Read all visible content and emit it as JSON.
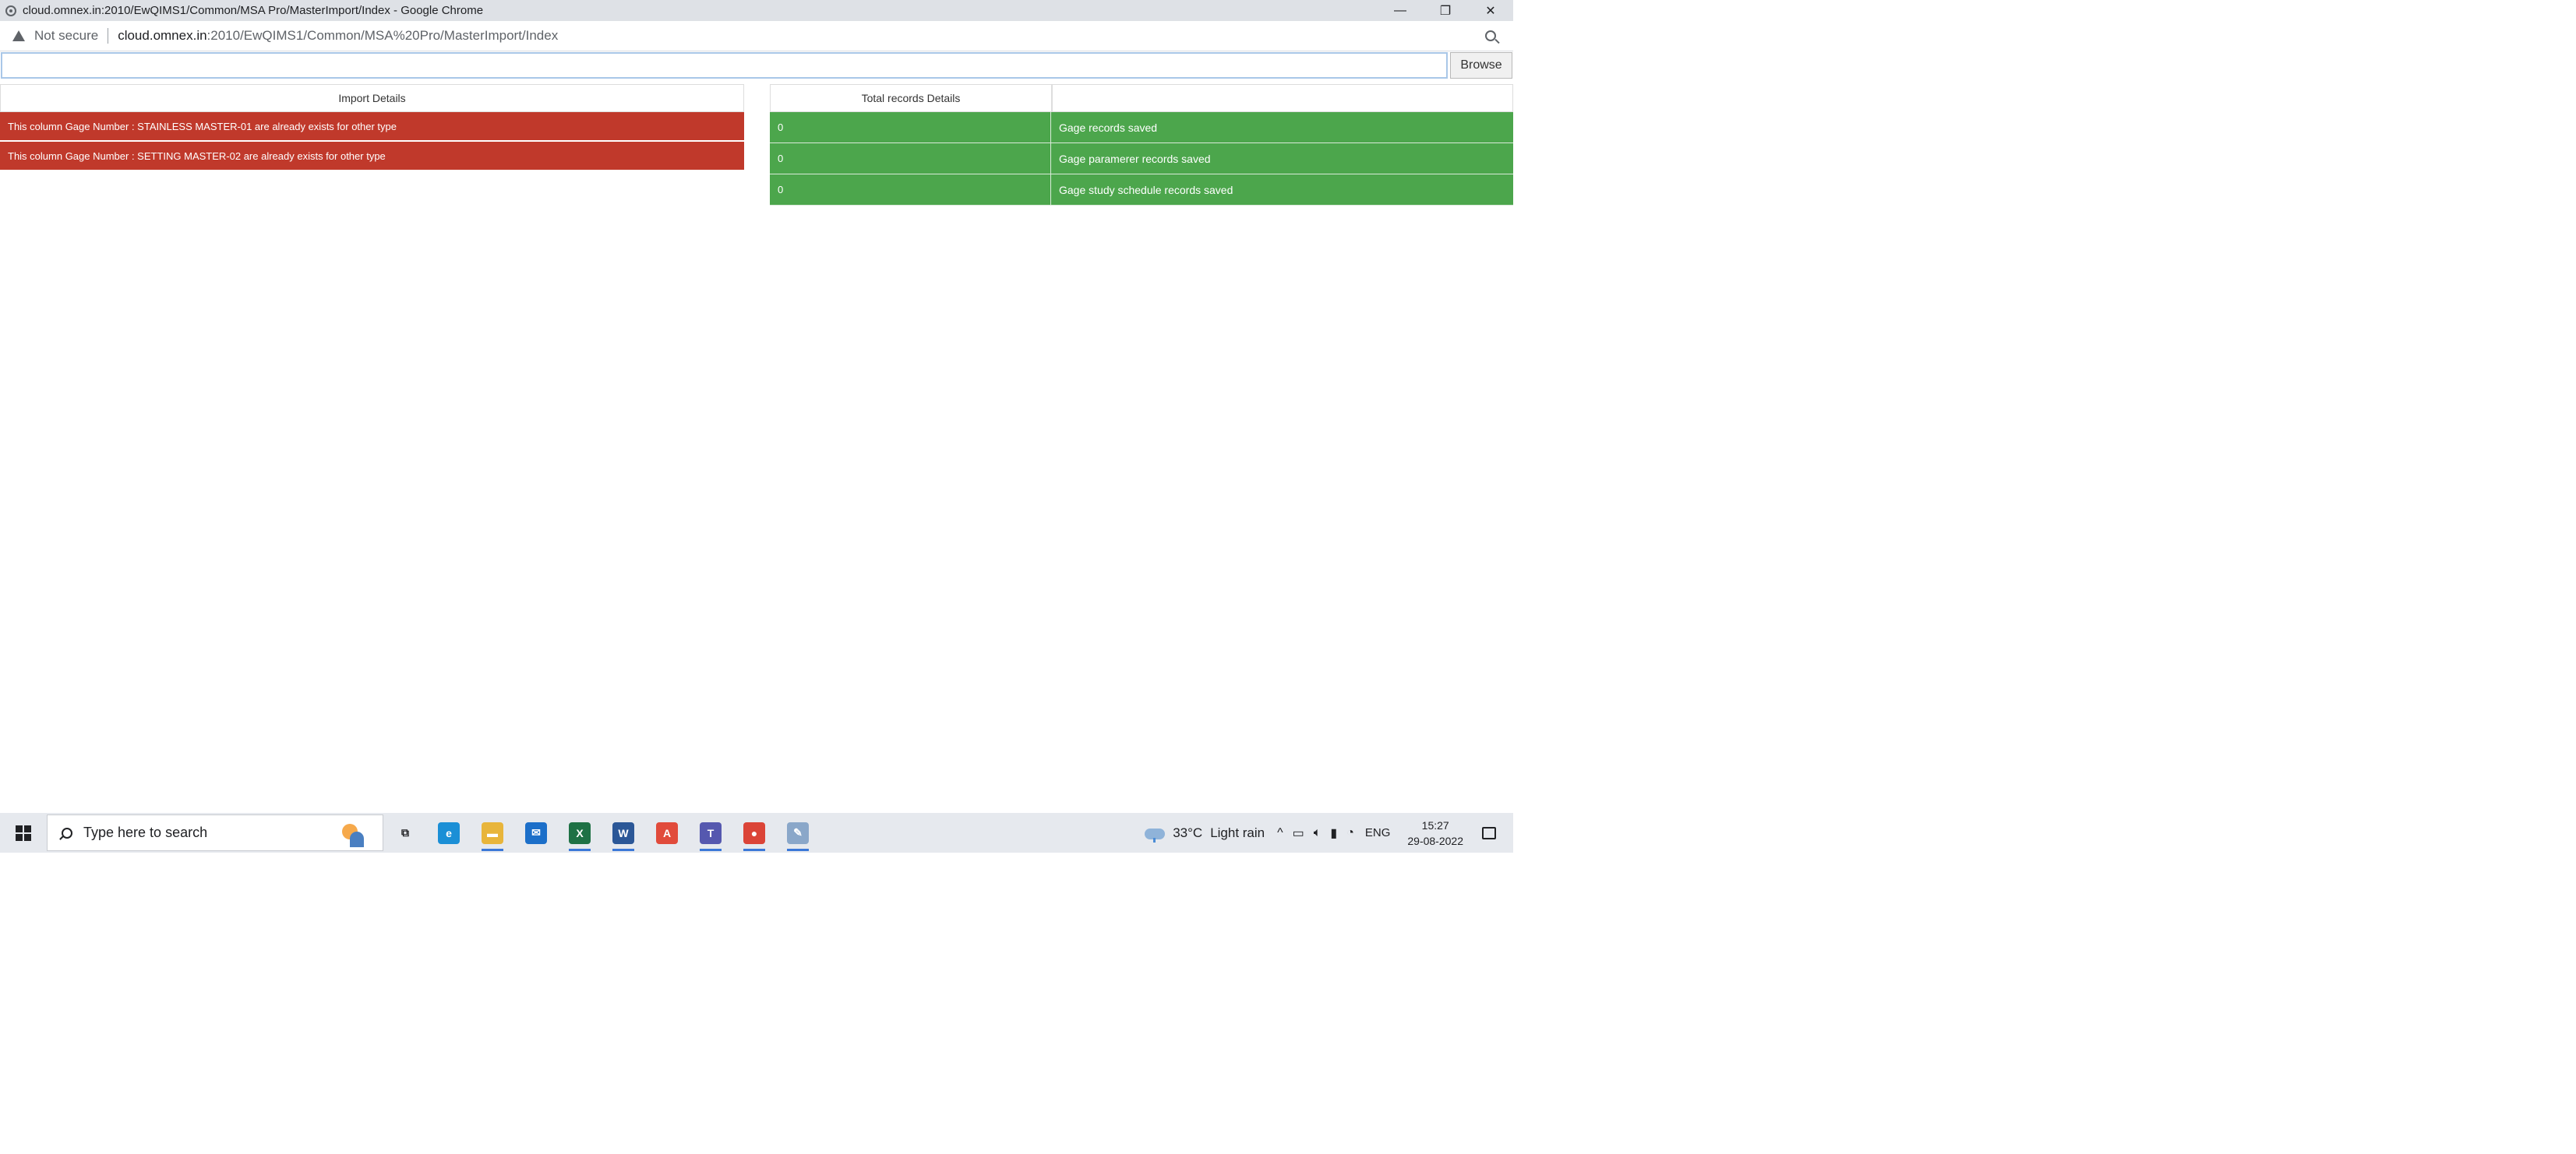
{
  "window": {
    "title": "cloud.omnex.in:2010/EwQIMS1/Common/MSA Pro/MasterImport/Index - Google Chrome",
    "controls": {
      "minimize": "—",
      "restore": "❐",
      "close": "✕"
    }
  },
  "addressbar": {
    "security_label": "Not secure",
    "url_host": "cloud.omnex.in",
    "url_path": ":2010/EwQIMS1/Common/MSA%20Pro/MasterImport/Index"
  },
  "file_upload": {
    "value": "",
    "browse_label": "Browse"
  },
  "import_details": {
    "header": "Import Details",
    "rows": [
      "This column Gage Number : STAINLESS MASTER-01 are already exists for other type",
      "This column Gage Number : SETTING MASTER-02 are already exists for other type"
    ],
    "row_color": "#c0392b"
  },
  "total_records": {
    "header": "Total records Details",
    "header_2": "",
    "rows": [
      {
        "count": "0",
        "label": "Gage records saved"
      },
      {
        "count": "0",
        "label": "Gage paramerer records saved"
      },
      {
        "count": "0",
        "label": "Gage study schedule records saved"
      }
    ],
    "row_color": "#4ca64c"
  },
  "taskbar": {
    "search_placeholder": "Type here to search",
    "apps": [
      {
        "name": "task-view-icon",
        "glyph": "⧉",
        "color": "#202124",
        "active": false
      },
      {
        "name": "edge-icon",
        "glyph": "e",
        "color": "#1b8fd6",
        "active": false
      },
      {
        "name": "file-explorer-icon",
        "glyph": "▬",
        "color": "#e8b53b",
        "active": true
      },
      {
        "name": "mail-icon",
        "glyph": "✉",
        "color": "#1c6fc9",
        "active": false
      },
      {
        "name": "excel-icon",
        "glyph": "X",
        "color": "#1e7145",
        "active": true
      },
      {
        "name": "word-icon",
        "glyph": "W",
        "color": "#2b5797",
        "active": true
      },
      {
        "name": "acrobat-icon",
        "glyph": "A",
        "color": "#e14b3b",
        "active": false
      },
      {
        "name": "teams-icon",
        "glyph": "T",
        "color": "#5558af",
        "active": true
      },
      {
        "name": "chrome-icon",
        "glyph": "●",
        "color": "#db4437",
        "active": true
      },
      {
        "name": "paint-icon",
        "glyph": "✎",
        "color": "#8aa7c9",
        "active": true
      }
    ],
    "weather": {
      "temp": "33°C",
      "condition": "Light rain"
    },
    "tray": {
      "chevron": "^",
      "language": "ENG"
    },
    "clock": {
      "time": "15:27",
      "date": "29-08-2022"
    }
  }
}
